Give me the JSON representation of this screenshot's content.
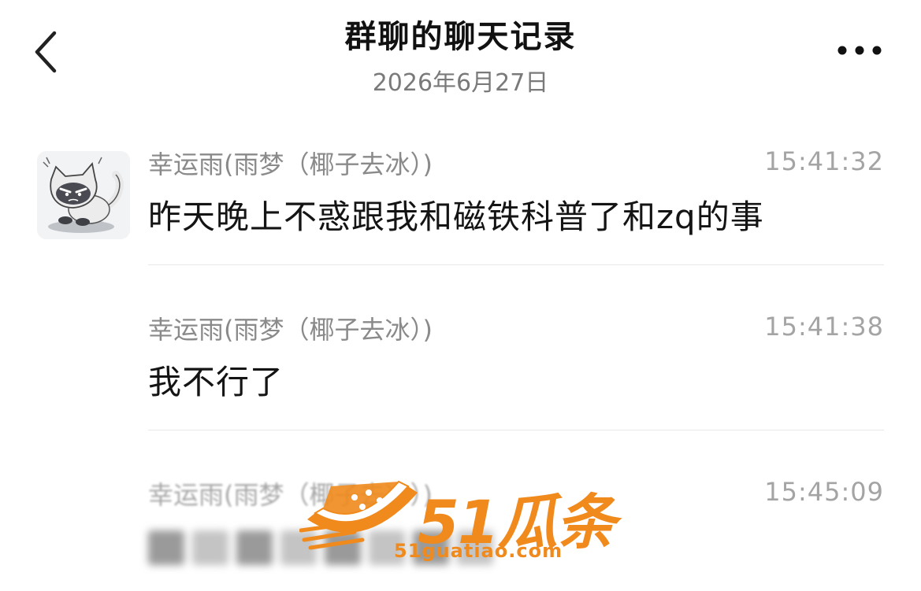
{
  "header": {
    "title": "群聊的聊天记录",
    "date": "2026年6月27日"
  },
  "messages": [
    {
      "sender": "幸运雨(雨梦（椰子去冰）)",
      "time": "15:41:32",
      "text": "昨天晚上不惑跟我和磁铁科普了和zq的事"
    },
    {
      "sender": "幸运雨(雨梦（椰子去冰）)",
      "time": "15:41:38",
      "text": "我不行了"
    },
    {
      "sender": "幸运雨(雨梦（椰子去冰）)",
      "time": "15:45:09"
    }
  ],
  "watermark": {
    "text": "51瓜条",
    "url": "51guatiao.com"
  },
  "colors": {
    "accent": "#f08a1c",
    "divider": "#e8e8e8",
    "muted_text": "#8a8a8a"
  },
  "icons": {
    "back": "chevron-left-icon",
    "more": "more-horizontal-icon"
  }
}
